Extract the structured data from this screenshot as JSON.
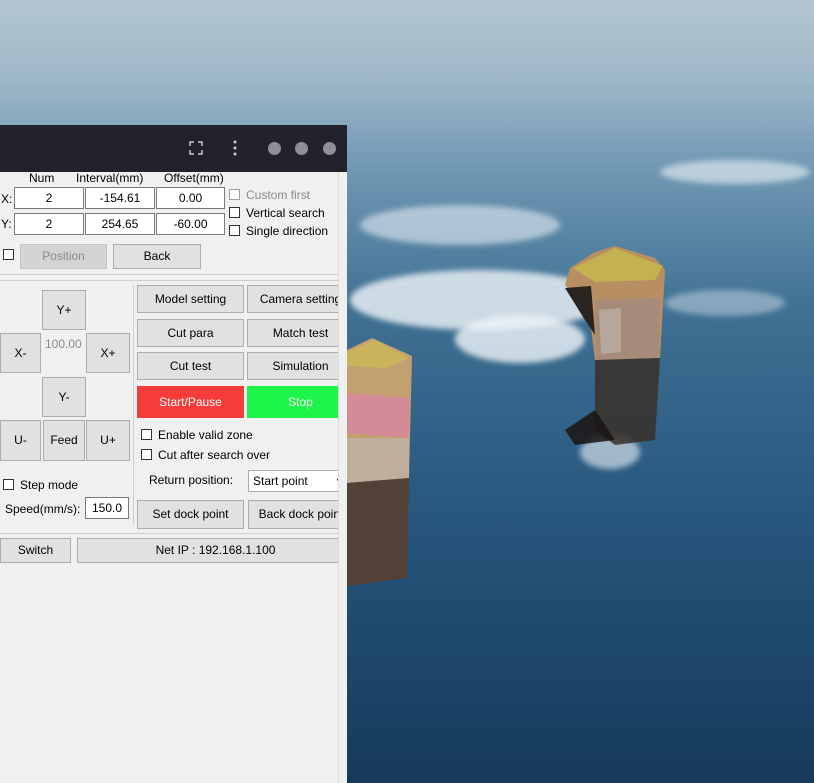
{
  "colors": {
    "titlebar": "#21222e",
    "start_pause": "#f63b3b",
    "stop": "#1ef54a",
    "panel": "#f0f0f0"
  },
  "titlebar": {
    "icons": [
      "fullscreen-icon",
      "more-vertical-icon"
    ]
  },
  "array": {
    "headers": {
      "num": "Num",
      "interval": "Interval(mm)",
      "offset": "Offset(mm)"
    },
    "x": {
      "label": "X:",
      "num": "2",
      "interval": "-154.61",
      "offset": "0.00"
    },
    "y": {
      "label": "Y:",
      "num": "2",
      "interval": "254.65",
      "offset": "-60.00"
    },
    "custom_first": "Custom first",
    "vertical_search": "Vertical search",
    "single_direction": "Single direction",
    "position_btn": "Position",
    "back_btn": "Back"
  },
  "jog": {
    "y_plus": "Y+",
    "x_minus": "X-",
    "step": "100.00",
    "x_plus": "X+",
    "y_minus": "Y-",
    "u_minus": "U-",
    "feed": "Feed",
    "u_plus": "U+",
    "step_mode": "Step mode",
    "speed_label": "Speed(mm/s):",
    "speed_value": "150.0"
  },
  "actions": {
    "model_setting": "Model setting",
    "camera_setting": "Camera setting",
    "cut_para": "Cut para",
    "match_test": "Match test",
    "cut_test": "Cut test",
    "simulation": "Simulation",
    "start_pause": "Start/Pause",
    "stop": "Stop",
    "enable_valid_zone": "Enable valid zone",
    "cut_after_search": "Cut after search over",
    "return_position_label": "Return position:",
    "return_position_value": "Start point",
    "set_dock_point": "Set dock point",
    "back_dock_point": "Back dock point"
  },
  "footer": {
    "switch": "Switch",
    "net_ip": "Net IP : 192.168.1.100"
  }
}
